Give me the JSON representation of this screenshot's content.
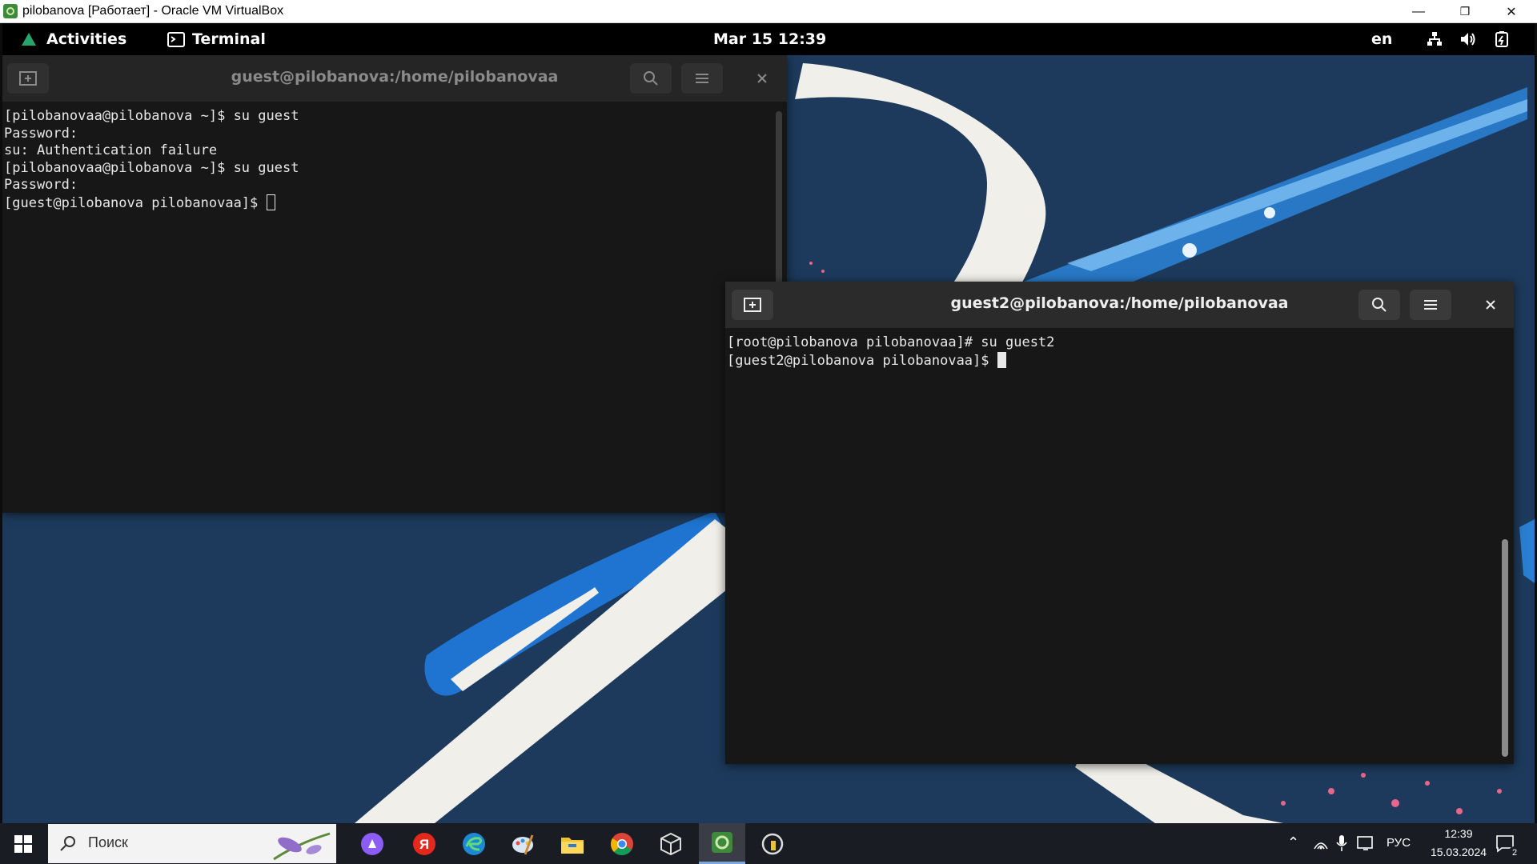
{
  "host_window": {
    "title": "pilobanova [Работает] - Oracle VM VirtualBox",
    "minimize": "—",
    "restore": "❐",
    "close": "✕"
  },
  "gnome": {
    "activities": "Activities",
    "app_name": "Terminal",
    "datetime": "Mar 15  12:39",
    "keyboard_layout": "en"
  },
  "terminal1": {
    "title": "guest@pilobanova:/home/pilobanovaa",
    "lines": [
      "[pilobanovaa@pilobanova ~]$ su guest",
      "Password:",
      "su: Authentication failure",
      "[pilobanovaa@pilobanova ~]$ su guest",
      "Password:"
    ],
    "prompt": "[guest@pilobanova pilobanovaa]$ "
  },
  "terminal2": {
    "title": "guest2@pilobanova:/home/pilobanovaa",
    "lines": [
      "[root@pilobanova pilobanovaa]# su guest2"
    ],
    "prompt": "[guest2@pilobanova pilobanovaa]$ "
  },
  "taskbar": {
    "search_placeholder": "Поиск",
    "language": "РУС",
    "time": "12:39",
    "date": "15.03.2024",
    "notification_count": "2"
  },
  "colors": {
    "terminal_bg": "#171717",
    "header_bg": "#2b2b2b",
    "wallpaper": "#1d3a5c",
    "taskbar": "#1a1c24"
  }
}
